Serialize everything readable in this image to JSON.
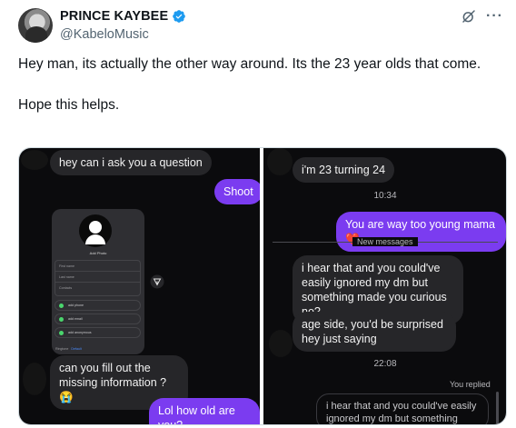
{
  "author": {
    "display_name": "PRINCE KAYBEE",
    "handle": "@KabeloMusic",
    "verified": true,
    "verified_color": "#1d9bf0"
  },
  "actions": {
    "grok_icon": "grok-icon",
    "more_icon": "ellipsis-icon",
    "more_label": "···"
  },
  "tweet": {
    "line1": "Hey man, its actually the other way around. Its the 23 year olds that come.",
    "line2": "Hope this helps."
  },
  "screenshot_left": {
    "messages": [
      {
        "text": "hey can i ask you a question",
        "direction": "in"
      },
      {
        "text": "Shoot",
        "direction": "out"
      },
      {
        "text": "can you fill out the missing information ?😭",
        "direction": "in"
      },
      {
        "text": "Lol how old are you?",
        "direction": "out"
      }
    ],
    "form": {
      "title": "Add Photo",
      "fields": [
        "First name",
        "Last name",
        "Contacts"
      ],
      "options": [
        "add phone",
        "add email",
        "add anonymous"
      ],
      "footer_label": "Ringtone",
      "footer_value": "Default"
    }
  },
  "screenshot_right": {
    "messages": [
      {
        "text": "i'm 23 turning 24",
        "direction": "in"
      },
      {
        "text": "You are way too young mama❤️",
        "direction": "out"
      },
      {
        "text": "i hear that and you could've easily ignored my dm but something made you curious no?",
        "direction": "in"
      },
      {
        "text": "age side, you'd be surprised hey just saying",
        "direction": "in"
      }
    ],
    "time1": "10:34",
    "divider": "New messages",
    "time2": "22:08",
    "you_replied": "You replied",
    "reply_preview": "i hear that and you could've easily ignored my dm but something made"
  },
  "colors": {
    "accent": "#7b3cf0",
    "bubble_in": "#262629",
    "background_dark": "#0b0b0d"
  }
}
